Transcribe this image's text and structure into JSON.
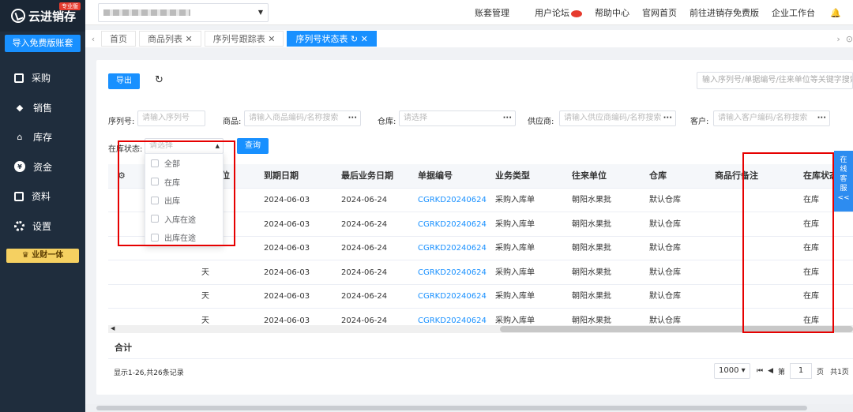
{
  "sidebar": {
    "logo_text": "云进销存",
    "logo_badge": "专业版",
    "import_label": "导入免费版账套",
    "items": [
      {
        "label": "采购",
        "icon": "bag-icon"
      },
      {
        "label": "销售",
        "icon": "flag-icon"
      },
      {
        "label": "库存",
        "icon": "warehouse-icon"
      },
      {
        "label": "资金",
        "icon": "yen-icon"
      },
      {
        "label": "资料",
        "icon": "book-icon"
      },
      {
        "label": "设置",
        "icon": "gear-icon"
      }
    ],
    "biz_label": "业财一体"
  },
  "topbar": {
    "links": [
      "账套管理",
      "用户论坛",
      "帮助中心",
      "官网首页",
      "前往进销存免费版",
      "企业工作台"
    ]
  },
  "tabs": {
    "items": [
      "首页",
      "商品列表 ✕",
      "序列号跟踪表 ✕"
    ],
    "active": "序列号状态表 ↻ ✕"
  },
  "toolbar": {
    "export_label": "导出",
    "refresh_icon": "↻",
    "keyword_placeholder": "输入序列号/单据编号/往来单位等关键字搜索"
  },
  "filters": {
    "serial_label": "序列号:",
    "serial_placeholder": "请输入序列号",
    "goods_label": "商品:",
    "goods_placeholder": "请输入商品编码/名称搜索",
    "warehouse_label": "仓库:",
    "warehouse_placeholder": "请选择",
    "supplier_label": "供应商:",
    "supplier_placeholder": "请输入供应商编码/名称搜索",
    "customer_label": "客户:",
    "customer_placeholder": "请输入客户编码/名称搜索",
    "status_label": "在库状态:",
    "status_placeholder": "请选择",
    "query_label": "查询",
    "more": "···"
  },
  "status_dropdown": {
    "options": [
      "全部",
      "在库",
      "出库",
      "入库在途",
      "出库在途"
    ]
  },
  "table": {
    "columns": [
      "位",
      "到期日期",
      "最后业务日期",
      "单据编号",
      "业务类型",
      "往来单位",
      "仓库",
      "商品行备注",
      "在库状态"
    ],
    "rows": [
      {
        "unit": "",
        "expiry": "2024-06-03",
        "last_date": "2024-06-24",
        "doc_no": "CGRKD20240624",
        "biz_type": "采购入库单",
        "partner": "朝阳水果批",
        "warehouse": "默认仓库",
        "remark": "",
        "status": "在库"
      },
      {
        "unit": "",
        "expiry": "2024-06-03",
        "last_date": "2024-06-24",
        "doc_no": "CGRKD20240624",
        "biz_type": "采购入库单",
        "partner": "朝阳水果批",
        "warehouse": "默认仓库",
        "remark": "",
        "status": "在库"
      },
      {
        "unit": "",
        "expiry": "2024-06-03",
        "last_date": "2024-06-24",
        "doc_no": "CGRKD20240624",
        "biz_type": "采购入库单",
        "partner": "朝阳水果批",
        "warehouse": "默认仓库",
        "remark": "",
        "status": "在库"
      },
      {
        "unit": "天",
        "expiry": "2024-06-03",
        "last_date": "2024-06-24",
        "doc_no": "CGRKD20240624",
        "biz_type": "采购入库单",
        "partner": "朝阳水果批",
        "warehouse": "默认仓库",
        "remark": "",
        "status": "在库"
      },
      {
        "unit": "天",
        "expiry": "2024-06-03",
        "last_date": "2024-06-24",
        "doc_no": "CGRKD20240624",
        "biz_type": "采购入库单",
        "partner": "朝阳水果批",
        "warehouse": "默认仓库",
        "remark": "",
        "status": "在库"
      },
      {
        "unit": "天",
        "expiry": "2024-06-03",
        "last_date": "2024-06-24",
        "doc_no": "CGRKD20240624",
        "biz_type": "采购入库单",
        "partner": "朝阳水果批",
        "warehouse": "默认仓库",
        "remark": "",
        "status": "在库"
      }
    ],
    "total_label": "合计"
  },
  "footer": {
    "records": "显示1-26,共26条记录",
    "page_size": "1000 ▾",
    "first": "⏮",
    "prev": "◀",
    "page_prefix": "第",
    "page_value": "1",
    "page_suffix": "页",
    "total_pages": "共1页"
  },
  "service": {
    "label": "在线客服",
    "arrow": "<<"
  },
  "colors": {
    "primary": "#1890ff",
    "sidebar": "#1f2d3d",
    "annotation": "#e60000"
  }
}
